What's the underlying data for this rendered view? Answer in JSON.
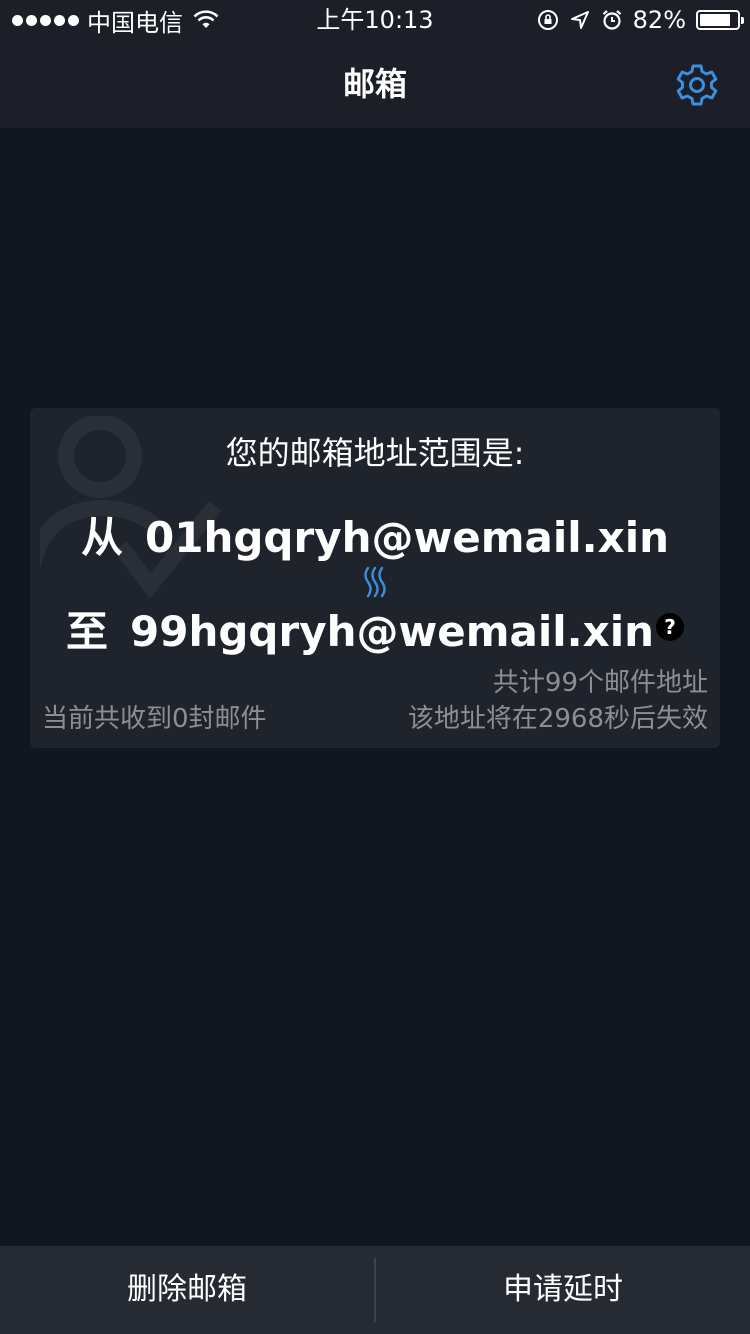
{
  "status_bar": {
    "carrier": "中国电信",
    "time": "上午10:13",
    "battery_percent_text": "82%",
    "battery_level": 0.82
  },
  "nav": {
    "title": "邮箱",
    "settings_icon": "gear-icon",
    "accent_color": "#3a8fdf"
  },
  "card": {
    "heading": "您的邮箱地址范围是:",
    "from_prefix": "从",
    "from_address": "01hgqryh@wemail.xin",
    "to_prefix": "至",
    "to_address": "99hgqryh@wemail.xin",
    "help_symbol": "?",
    "total_count": "共计99个邮件地址",
    "received": "当前共收到0封邮件",
    "expire": "该地址将在2968秒后失效"
  },
  "bottom_bar": {
    "delete_label": "删除邮箱",
    "extend_label": "申请延时"
  }
}
